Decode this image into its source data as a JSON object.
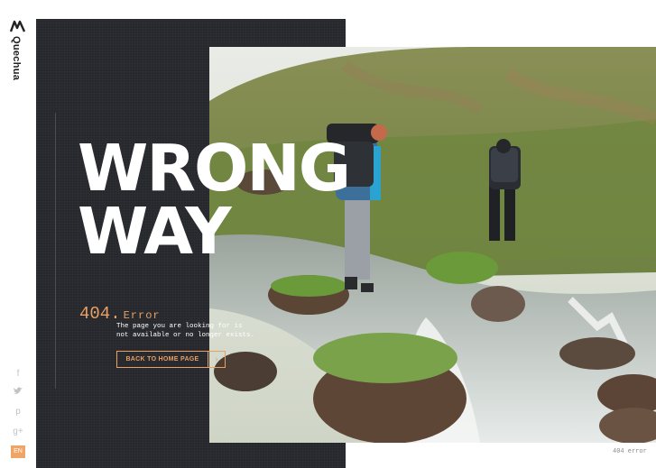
{
  "brand": {
    "name": "Quechua"
  },
  "hero": {
    "headline_line1": "WRONG",
    "headline_line2": "WAY"
  },
  "error": {
    "code": "404.",
    "word": "Error",
    "message_line1": "The page you are looking for is",
    "message_line2": "not available or no longer exists."
  },
  "cta": {
    "label": "BACK TO HOME PAGE",
    "arrow": "›"
  },
  "social": {
    "facebook": "f",
    "twitter": "✦",
    "pinterest": "p",
    "googleplus": "g+"
  },
  "language": {
    "current": "EN"
  },
  "footer": {
    "label": "404 error"
  },
  "colors": {
    "accent": "#e8a063",
    "panel": "#26282d",
    "lang_bg": "#f0a466"
  },
  "icons": [
    "quechua-logo-icon",
    "facebook-icon",
    "twitter-icon",
    "pinterest-icon",
    "googleplus-icon",
    "chevron-right-icon"
  ]
}
